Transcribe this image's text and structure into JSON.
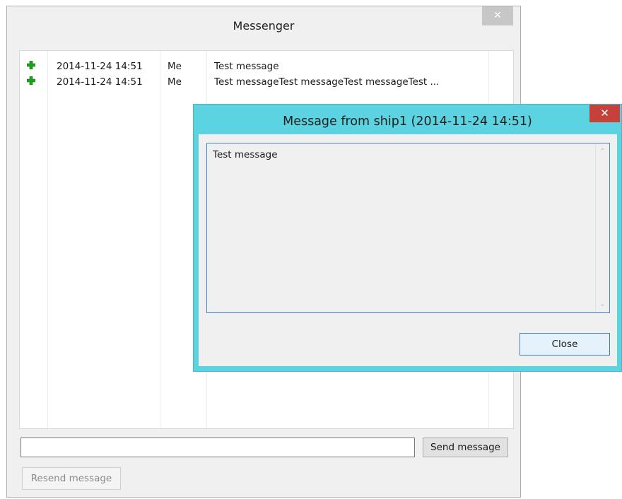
{
  "messenger": {
    "title": "Messenger",
    "close_glyph": "✕",
    "messages": [
      {
        "icon": "green-plus-icon",
        "date": "2014-11-24 14:51",
        "from": "Me",
        "text": "Test message"
      },
      {
        "icon": "green-plus-icon",
        "date": "2014-11-24 14:51",
        "from": "Me",
        "text": "Test messageTest messageTest messageTest ..."
      }
    ],
    "input": {
      "value": "",
      "placeholder": ""
    },
    "send_label": "Send message",
    "resend_label": "Resend message"
  },
  "dialog": {
    "title": "Message from ship1 (2014-11-24 14:51)",
    "close_glyph": "✕",
    "message_text": "Test message",
    "close_label": "Close",
    "scroll_up_glyph": "⌃",
    "scroll_down_glyph": "⌄"
  },
  "colors": {
    "dialog_frame": "#5cd3e1",
    "dialog_close": "#c7413b",
    "plus_icon": "#1fa01f"
  }
}
